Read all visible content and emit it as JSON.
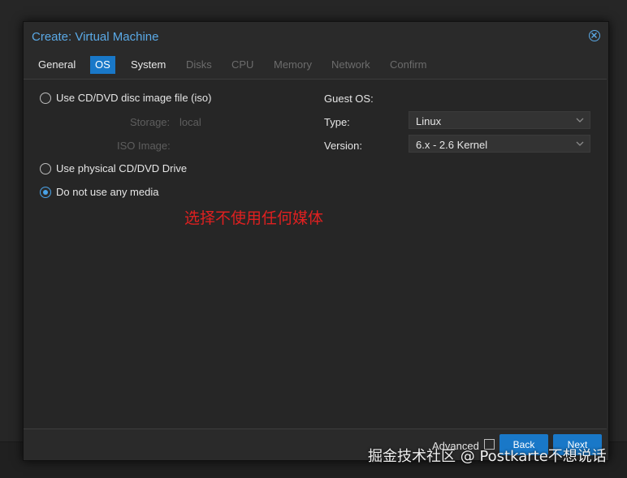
{
  "dialog": {
    "title": "Create: Virtual Machine",
    "close_icon": "close-circle-icon"
  },
  "tabs": [
    {
      "label": "General",
      "state": "enabled"
    },
    {
      "label": "OS",
      "state": "active"
    },
    {
      "label": "System",
      "state": "enabled"
    },
    {
      "label": "Disks",
      "state": "disabled"
    },
    {
      "label": "CPU",
      "state": "disabled"
    },
    {
      "label": "Memory",
      "state": "disabled"
    },
    {
      "label": "Network",
      "state": "disabled"
    },
    {
      "label": "Confirm",
      "state": "disabled"
    }
  ],
  "media": {
    "option_iso": "Use CD/DVD disc image file (iso)",
    "storage_label": "Storage:",
    "storage_value": "local",
    "iso_image_label": "ISO Image:",
    "option_physical": "Use physical CD/DVD Drive",
    "option_none": "Do not use any media",
    "selected": "none"
  },
  "guest_os": {
    "heading": "Guest OS:",
    "type_label": "Type:",
    "type_value": "Linux",
    "version_label": "Version:",
    "version_value": "6.x - 2.6 Kernel"
  },
  "annotation": "选择不使用任何媒体",
  "footer": {
    "advanced_label": "Advanced",
    "advanced_checked": false,
    "back_label": "Back",
    "next_label": "Next"
  },
  "watermark": "掘金技术社区 @ Postkarte不想说话",
  "colors": {
    "accent": "#1978c8",
    "title": "#5aa9e6",
    "annotation": "#e02020"
  }
}
